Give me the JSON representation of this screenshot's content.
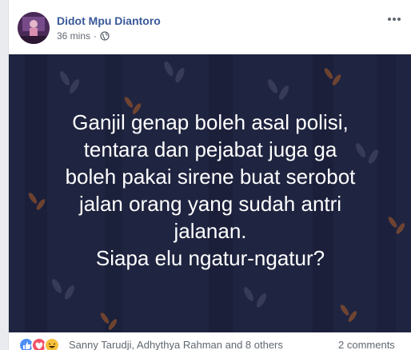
{
  "post": {
    "author": "Didot Mpu Diantoro",
    "time": "36 mins",
    "separator": "·",
    "privacy_icon": "globe-icon",
    "more_icon": "more-options-icon",
    "quote_lines": [
      "Ganjil genap boleh asal polisi,",
      "tentara dan pejabat juga ga",
      "boleh pakai sirene buat serobot",
      "jalan orang yang sudah antri",
      "jalanan.",
      "Siapa elu ngatur-ngatur?"
    ],
    "image_background_color": "#1f2440",
    "text_color": "#ffffff"
  },
  "footer": {
    "reactions": [
      "like-icon",
      "love-icon",
      "haha-icon"
    ],
    "reacted_by": "Sanny Tarudji, Adhythya Rahman and 8 others",
    "comments": "2 comments"
  },
  "colors": {
    "author_link": "#385898",
    "meta_text": "#606770",
    "like": "#4e8ef7",
    "love": "#f25268",
    "haha": "#f7c13b"
  }
}
